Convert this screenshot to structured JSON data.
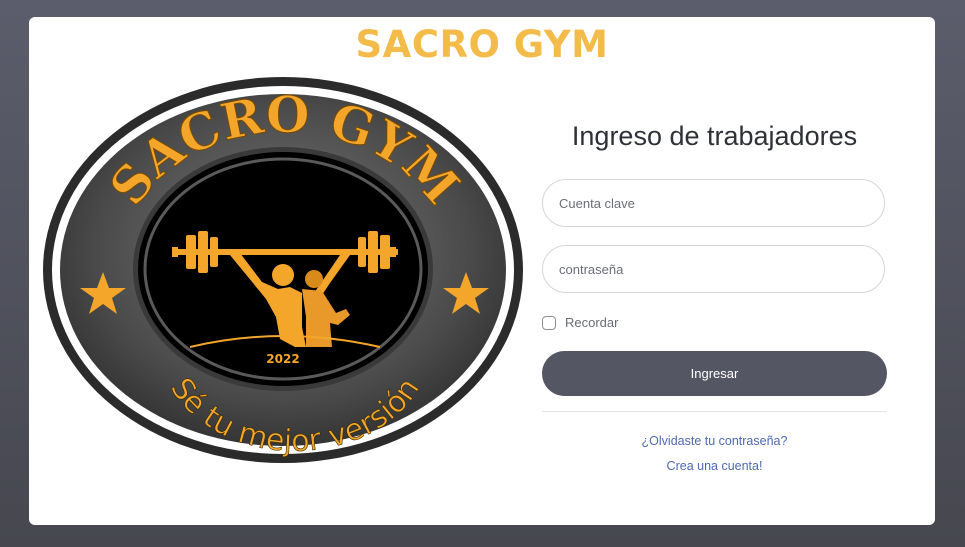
{
  "header": {
    "title": "SACRO GYM"
  },
  "logo": {
    "top_text": "SACRO GYM",
    "year": "2022",
    "slogan": "Sé tu mejor versión",
    "colors": {
      "gold": "#f3a62a",
      "ring": "#2a2a2a",
      "dark": "#000000"
    }
  },
  "login": {
    "title": "Ingreso de trabajadores",
    "username_placeholder": "Cuenta clave",
    "password_placeholder": "contraseña",
    "remember_label": "Recordar",
    "submit_label": "Ingresar",
    "forgot_link": "¿Olvidaste tu contraseña?",
    "create_link": "Crea una cuenta!"
  },
  "colors": {
    "accent_yellow": "#f3bb4a",
    "button_bg": "#555663",
    "link": "#4f69b3"
  }
}
